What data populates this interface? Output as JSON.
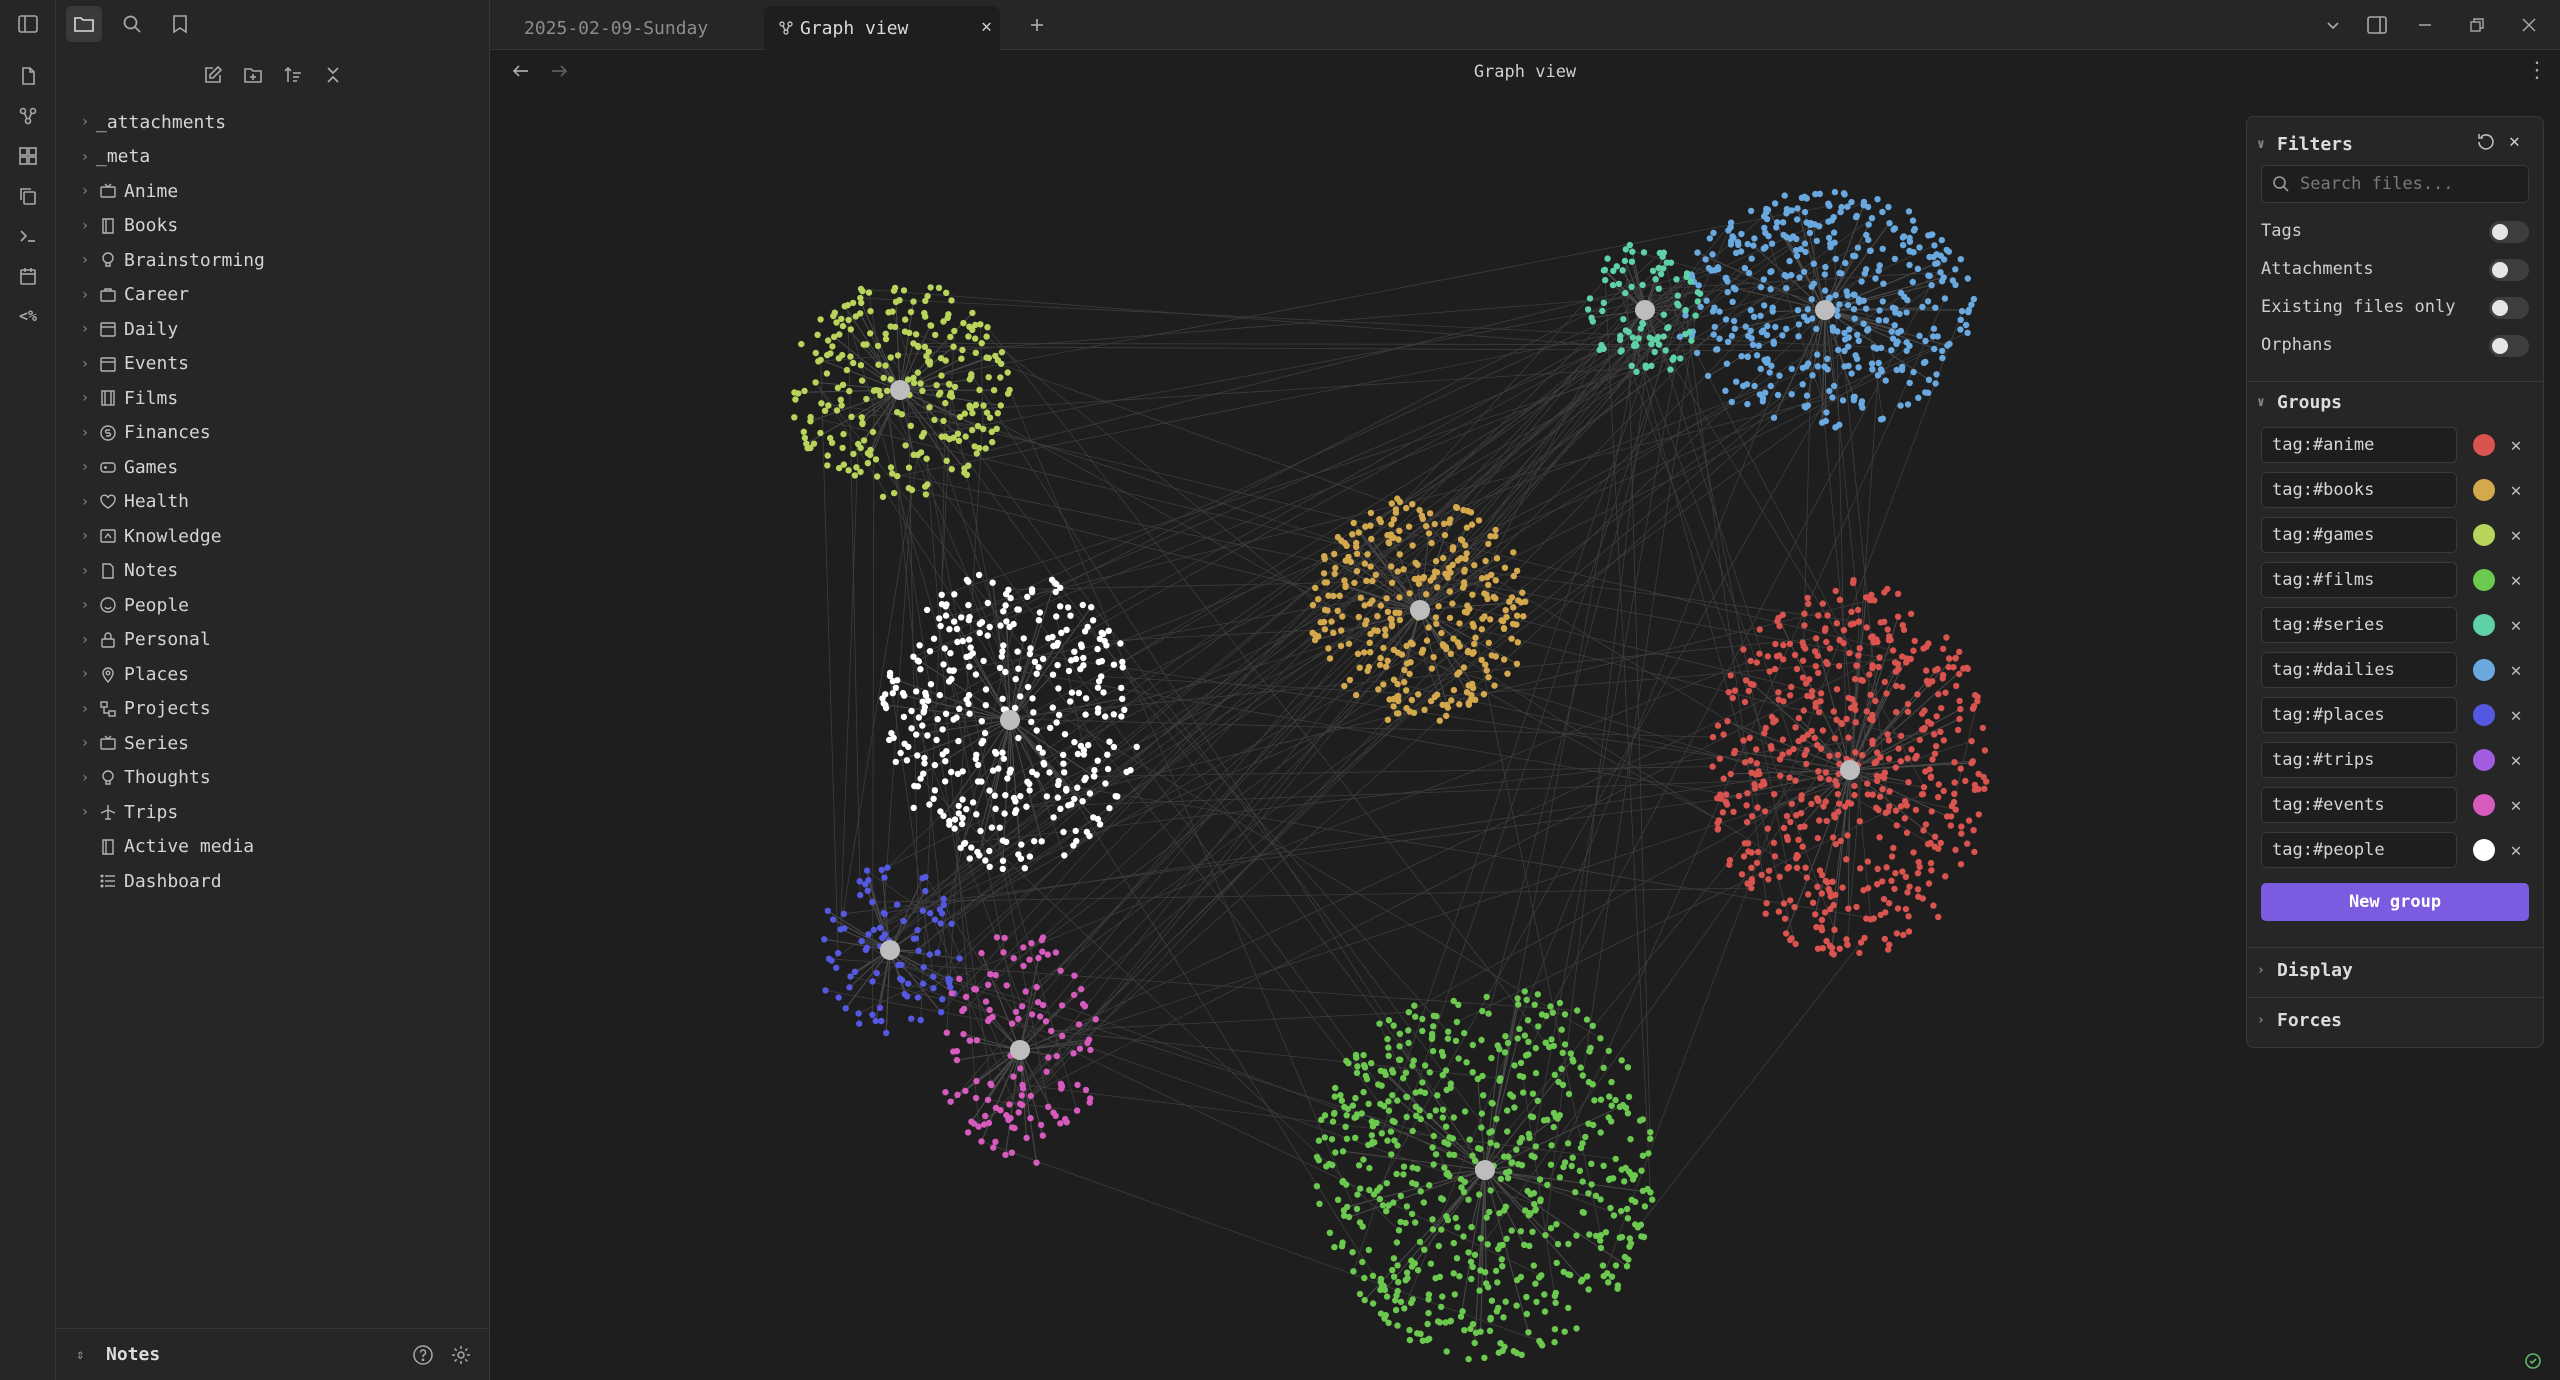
{
  "colors": {
    "accent": "#7b5ce0",
    "background": "#1e1e1e",
    "panel": "#262626"
  },
  "tabs": [
    {
      "label": "2025-02-09-Sunday",
      "active": false
    },
    {
      "label": "Graph view",
      "active": true,
      "icon": "graph-icon"
    }
  ],
  "view": {
    "title": "Graph view"
  },
  "sidebar": {
    "toolbar_icons": [
      "new-note-icon",
      "new-folder-icon",
      "sort-icon",
      "collapse-all-icon"
    ],
    "tree": [
      {
        "label": "_attachments",
        "folder": true,
        "icon": ""
      },
      {
        "label": "_meta",
        "folder": true,
        "icon": ""
      },
      {
        "label": "Anime",
        "folder": true,
        "icon": "tv-icon"
      },
      {
        "label": "Books",
        "folder": true,
        "icon": "book-icon"
      },
      {
        "label": "Brainstorming",
        "folder": true,
        "icon": "bulb-icon"
      },
      {
        "label": "Career",
        "folder": true,
        "icon": "briefcase-icon"
      },
      {
        "label": "Daily",
        "folder": true,
        "icon": "calendar-icon"
      },
      {
        "label": "Events",
        "folder": true,
        "icon": "calendar-icon"
      },
      {
        "label": "Films",
        "folder": true,
        "icon": "film-icon"
      },
      {
        "label": "Finances",
        "folder": true,
        "icon": "coin-icon"
      },
      {
        "label": "Games",
        "folder": true,
        "icon": "gamepad-icon"
      },
      {
        "label": "Health",
        "folder": true,
        "icon": "heart-icon"
      },
      {
        "label": "Knowledge",
        "folder": true,
        "icon": "brain-icon"
      },
      {
        "label": "Notes",
        "folder": true,
        "icon": "note-icon"
      },
      {
        "label": "People",
        "folder": true,
        "icon": "smile-icon"
      },
      {
        "label": "Personal",
        "folder": true,
        "icon": "lock-icon"
      },
      {
        "label": "Places",
        "folder": true,
        "icon": "pin-icon"
      },
      {
        "label": "Projects",
        "folder": true,
        "icon": "project-icon"
      },
      {
        "label": "Series",
        "folder": true,
        "icon": "tv-icon"
      },
      {
        "label": "Thoughts",
        "folder": true,
        "icon": "bulb-icon"
      },
      {
        "label": "Trips",
        "folder": true,
        "icon": "plane-icon"
      },
      {
        "label": "Active media",
        "folder": false,
        "icon": "book-icon"
      },
      {
        "label": "Dashboard",
        "folder": false,
        "icon": "list-icon"
      }
    ],
    "vault_name": "Notes"
  },
  "filters": {
    "title": "Filters",
    "search_placeholder": "Search files...",
    "options": [
      {
        "label": "Tags",
        "on": false
      },
      {
        "label": "Attachments",
        "on": false
      },
      {
        "label": "Existing files only",
        "on": false
      },
      {
        "label": "Orphans",
        "on": false
      }
    ],
    "groups_title": "Groups",
    "groups": [
      {
        "query": "tag:#anime",
        "color": "#d9534f"
      },
      {
        "query": "tag:#books",
        "color": "#d4a94e"
      },
      {
        "query": "tag:#games",
        "color": "#b8d45a"
      },
      {
        "query": "tag:#films",
        "color": "#6cc94f"
      },
      {
        "query": "tag:#series",
        "color": "#5fd1a6"
      },
      {
        "query": "tag:#dailies",
        "color": "#6aa9e0"
      },
      {
        "query": "tag:#places",
        "color": "#5558e0"
      },
      {
        "query": "tag:#trips",
        "color": "#a25ce0"
      },
      {
        "query": "tag:#events",
        "color": "#d65bbd"
      },
      {
        "query": "tag:#people",
        "color": "#ffffff"
      }
    ],
    "new_group_label": "New group",
    "display_title": "Display",
    "forces_title": "Forces"
  },
  "graph_clusters": [
    {
      "name": "dailies",
      "color": "#6aa9e0",
      "n": 420
    },
    {
      "name": "games",
      "color": "#b8d45a",
      "n": 260
    },
    {
      "name": "series",
      "color": "#5fd1a6",
      "n": 90
    },
    {
      "name": "books",
      "color": "#d4a94e",
      "n": 330
    },
    {
      "name": "anime",
      "color": "#d9534f",
      "n": 560
    },
    {
      "name": "films",
      "color": "#6cc94f",
      "n": 620
    },
    {
      "name": "people",
      "color": "#ffffff",
      "n": 360
    },
    {
      "name": "places",
      "color": "#5558e0",
      "n": 90
    },
    {
      "name": "events",
      "color": "#d65bbd",
      "n": 130
    }
  ]
}
